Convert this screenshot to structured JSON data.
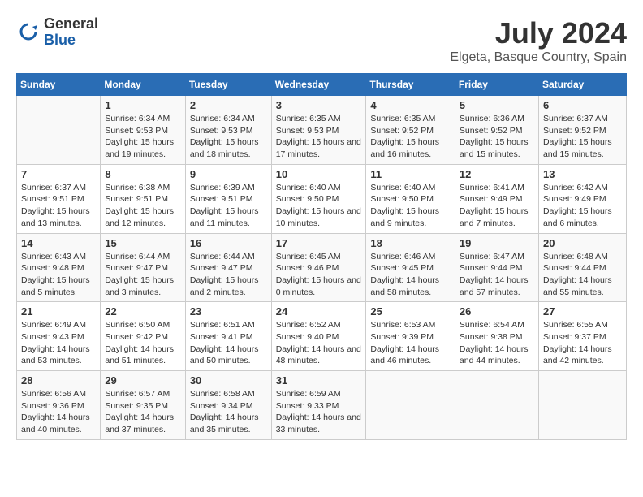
{
  "logo": {
    "general": "General",
    "blue": "Blue"
  },
  "title": "July 2024",
  "subtitle": "Elgeta, Basque Country, Spain",
  "days_of_week": [
    "Sunday",
    "Monday",
    "Tuesday",
    "Wednesday",
    "Thursday",
    "Friday",
    "Saturday"
  ],
  "weeks": [
    [
      {
        "day": "",
        "sunrise": "",
        "sunset": "",
        "daylight": ""
      },
      {
        "day": "1",
        "sunrise": "Sunrise: 6:34 AM",
        "sunset": "Sunset: 9:53 PM",
        "daylight": "Daylight: 15 hours and 19 minutes."
      },
      {
        "day": "2",
        "sunrise": "Sunrise: 6:34 AM",
        "sunset": "Sunset: 9:53 PM",
        "daylight": "Daylight: 15 hours and 18 minutes."
      },
      {
        "day": "3",
        "sunrise": "Sunrise: 6:35 AM",
        "sunset": "Sunset: 9:53 PM",
        "daylight": "Daylight: 15 hours and 17 minutes."
      },
      {
        "day": "4",
        "sunrise": "Sunrise: 6:35 AM",
        "sunset": "Sunset: 9:52 PM",
        "daylight": "Daylight: 15 hours and 16 minutes."
      },
      {
        "day": "5",
        "sunrise": "Sunrise: 6:36 AM",
        "sunset": "Sunset: 9:52 PM",
        "daylight": "Daylight: 15 hours and 15 minutes."
      },
      {
        "day": "6",
        "sunrise": "Sunrise: 6:37 AM",
        "sunset": "Sunset: 9:52 PM",
        "daylight": "Daylight: 15 hours and 15 minutes."
      }
    ],
    [
      {
        "day": "7",
        "sunrise": "Sunrise: 6:37 AM",
        "sunset": "Sunset: 9:51 PM",
        "daylight": "Daylight: 15 hours and 13 minutes."
      },
      {
        "day": "8",
        "sunrise": "Sunrise: 6:38 AM",
        "sunset": "Sunset: 9:51 PM",
        "daylight": "Daylight: 15 hours and 12 minutes."
      },
      {
        "day": "9",
        "sunrise": "Sunrise: 6:39 AM",
        "sunset": "Sunset: 9:51 PM",
        "daylight": "Daylight: 15 hours and 11 minutes."
      },
      {
        "day": "10",
        "sunrise": "Sunrise: 6:40 AM",
        "sunset": "Sunset: 9:50 PM",
        "daylight": "Daylight: 15 hours and 10 minutes."
      },
      {
        "day": "11",
        "sunrise": "Sunrise: 6:40 AM",
        "sunset": "Sunset: 9:50 PM",
        "daylight": "Daylight: 15 hours and 9 minutes."
      },
      {
        "day": "12",
        "sunrise": "Sunrise: 6:41 AM",
        "sunset": "Sunset: 9:49 PM",
        "daylight": "Daylight: 15 hours and 7 minutes."
      },
      {
        "day": "13",
        "sunrise": "Sunrise: 6:42 AM",
        "sunset": "Sunset: 9:49 PM",
        "daylight": "Daylight: 15 hours and 6 minutes."
      }
    ],
    [
      {
        "day": "14",
        "sunrise": "Sunrise: 6:43 AM",
        "sunset": "Sunset: 9:48 PM",
        "daylight": "Daylight: 15 hours and 5 minutes."
      },
      {
        "day": "15",
        "sunrise": "Sunrise: 6:44 AM",
        "sunset": "Sunset: 9:47 PM",
        "daylight": "Daylight: 15 hours and 3 minutes."
      },
      {
        "day": "16",
        "sunrise": "Sunrise: 6:44 AM",
        "sunset": "Sunset: 9:47 PM",
        "daylight": "Daylight: 15 hours and 2 minutes."
      },
      {
        "day": "17",
        "sunrise": "Sunrise: 6:45 AM",
        "sunset": "Sunset: 9:46 PM",
        "daylight": "Daylight: 15 hours and 0 minutes."
      },
      {
        "day": "18",
        "sunrise": "Sunrise: 6:46 AM",
        "sunset": "Sunset: 9:45 PM",
        "daylight": "Daylight: 14 hours and 58 minutes."
      },
      {
        "day": "19",
        "sunrise": "Sunrise: 6:47 AM",
        "sunset": "Sunset: 9:44 PM",
        "daylight": "Daylight: 14 hours and 57 minutes."
      },
      {
        "day": "20",
        "sunrise": "Sunrise: 6:48 AM",
        "sunset": "Sunset: 9:44 PM",
        "daylight": "Daylight: 14 hours and 55 minutes."
      }
    ],
    [
      {
        "day": "21",
        "sunrise": "Sunrise: 6:49 AM",
        "sunset": "Sunset: 9:43 PM",
        "daylight": "Daylight: 14 hours and 53 minutes."
      },
      {
        "day": "22",
        "sunrise": "Sunrise: 6:50 AM",
        "sunset": "Sunset: 9:42 PM",
        "daylight": "Daylight: 14 hours and 51 minutes."
      },
      {
        "day": "23",
        "sunrise": "Sunrise: 6:51 AM",
        "sunset": "Sunset: 9:41 PM",
        "daylight": "Daylight: 14 hours and 50 minutes."
      },
      {
        "day": "24",
        "sunrise": "Sunrise: 6:52 AM",
        "sunset": "Sunset: 9:40 PM",
        "daylight": "Daylight: 14 hours and 48 minutes."
      },
      {
        "day": "25",
        "sunrise": "Sunrise: 6:53 AM",
        "sunset": "Sunset: 9:39 PM",
        "daylight": "Daylight: 14 hours and 46 minutes."
      },
      {
        "day": "26",
        "sunrise": "Sunrise: 6:54 AM",
        "sunset": "Sunset: 9:38 PM",
        "daylight": "Daylight: 14 hours and 44 minutes."
      },
      {
        "day": "27",
        "sunrise": "Sunrise: 6:55 AM",
        "sunset": "Sunset: 9:37 PM",
        "daylight": "Daylight: 14 hours and 42 minutes."
      }
    ],
    [
      {
        "day": "28",
        "sunrise": "Sunrise: 6:56 AM",
        "sunset": "Sunset: 9:36 PM",
        "daylight": "Daylight: 14 hours and 40 minutes."
      },
      {
        "day": "29",
        "sunrise": "Sunrise: 6:57 AM",
        "sunset": "Sunset: 9:35 PM",
        "daylight": "Daylight: 14 hours and 37 minutes."
      },
      {
        "day": "30",
        "sunrise": "Sunrise: 6:58 AM",
        "sunset": "Sunset: 9:34 PM",
        "daylight": "Daylight: 14 hours and 35 minutes."
      },
      {
        "day": "31",
        "sunrise": "Sunrise: 6:59 AM",
        "sunset": "Sunset: 9:33 PM",
        "daylight": "Daylight: 14 hours and 33 minutes."
      },
      {
        "day": "",
        "sunrise": "",
        "sunset": "",
        "daylight": ""
      },
      {
        "day": "",
        "sunrise": "",
        "sunset": "",
        "daylight": ""
      },
      {
        "day": "",
        "sunrise": "",
        "sunset": "",
        "daylight": ""
      }
    ]
  ]
}
